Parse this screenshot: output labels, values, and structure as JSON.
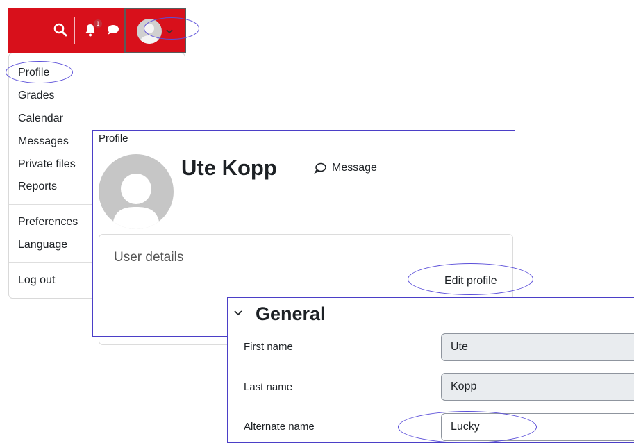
{
  "navbar": {
    "notification_count": "1",
    "icons": [
      "search-icon",
      "bell-icon",
      "chat-icon",
      "chevron-down-icon"
    ]
  },
  "user_menu": {
    "items": [
      "Profile",
      "Grades",
      "Calendar",
      "Messages",
      "Private files",
      "Reports",
      "Preferences",
      "Language",
      "Log out"
    ]
  },
  "profile": {
    "panel_title": "Profile",
    "name": "Ute Kopp",
    "message_label": "Message",
    "details_title": "User details",
    "edit_profile_label": "Edit profile"
  },
  "general": {
    "section_title": "General",
    "fields": [
      {
        "label": "First name",
        "value": "Ute"
      },
      {
        "label": "Last name",
        "value": "Kopp"
      },
      {
        "label": "Alternate name",
        "value": "Lucky"
      }
    ]
  },
  "colors": {
    "navbar_bg": "#d8101b",
    "annotation": "#5b4fd9",
    "input_disabled": "#e9ecef"
  }
}
